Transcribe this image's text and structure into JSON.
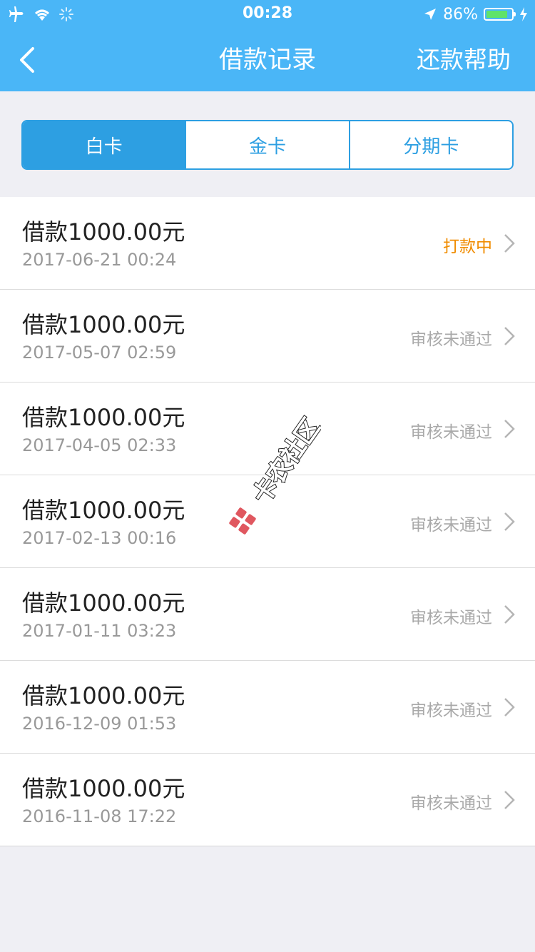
{
  "status_bar": {
    "time": "00:28",
    "battery": "86%",
    "battery_level": 0.86
  },
  "nav": {
    "title": "借款记录",
    "right_label": "还款帮助"
  },
  "tabs": [
    {
      "label": "白卡",
      "active": true
    },
    {
      "label": "金卡",
      "active": false
    },
    {
      "label": "分期卡",
      "active": false
    }
  ],
  "records": [
    {
      "amount": "借款1000.00元",
      "date": "2017-06-21 00:24",
      "status": "打款中"
    },
    {
      "amount": "借款1000.00元",
      "date": "2017-05-07 02:59",
      "status": "审核未通过"
    },
    {
      "amount": "借款1000.00元",
      "date": "2017-04-05 02:33",
      "status": "审核未通过"
    },
    {
      "amount": "借款1000.00元",
      "date": "2017-02-13 00:16",
      "status": "审核未通过"
    },
    {
      "amount": "借款1000.00元",
      "date": "2017-01-11 03:23",
      "status": "审核未通过"
    },
    {
      "amount": "借款1000.00元",
      "date": "2016-12-09 01:53",
      "status": "审核未通过"
    },
    {
      "amount": "借款1000.00元",
      "date": "2016-11-08 17:22",
      "status": "审核未通过"
    }
  ],
  "watermark": {
    "text": "卡农社区"
  },
  "colors": {
    "nav_blue": "#4ab6f7",
    "tab_blue": "#2d9fe2",
    "status_paying": "#f08c00",
    "status_rejected": "#a9a9a9"
  }
}
